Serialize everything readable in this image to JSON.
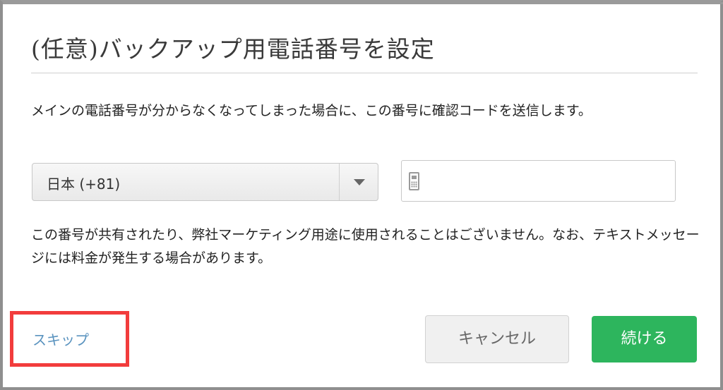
{
  "dialog": {
    "title": "(任意)バックアップ用電話番号を設定",
    "description": "メインの電話番号が分からなくなってしまった場合に、この番号に確認コードを送信します。",
    "note": "この番号が共有されたり、弊社マーケティング用途に使用されることはございません。なお、テキストメッセージには料金が発生する場合があります。"
  },
  "country_select": {
    "selected": "日本 (+81)",
    "icon": "chevron-down-icon"
  },
  "phone_field": {
    "value": "",
    "placeholder": "",
    "icon": "mobile-phone-icon"
  },
  "actions": {
    "skip_label": "スキップ",
    "cancel_label": "キャンセル",
    "continue_label": "続ける"
  },
  "colors": {
    "accent_green": "#2db55d",
    "link_blue": "#5a93bf",
    "highlight_red": "#f23c3c"
  }
}
